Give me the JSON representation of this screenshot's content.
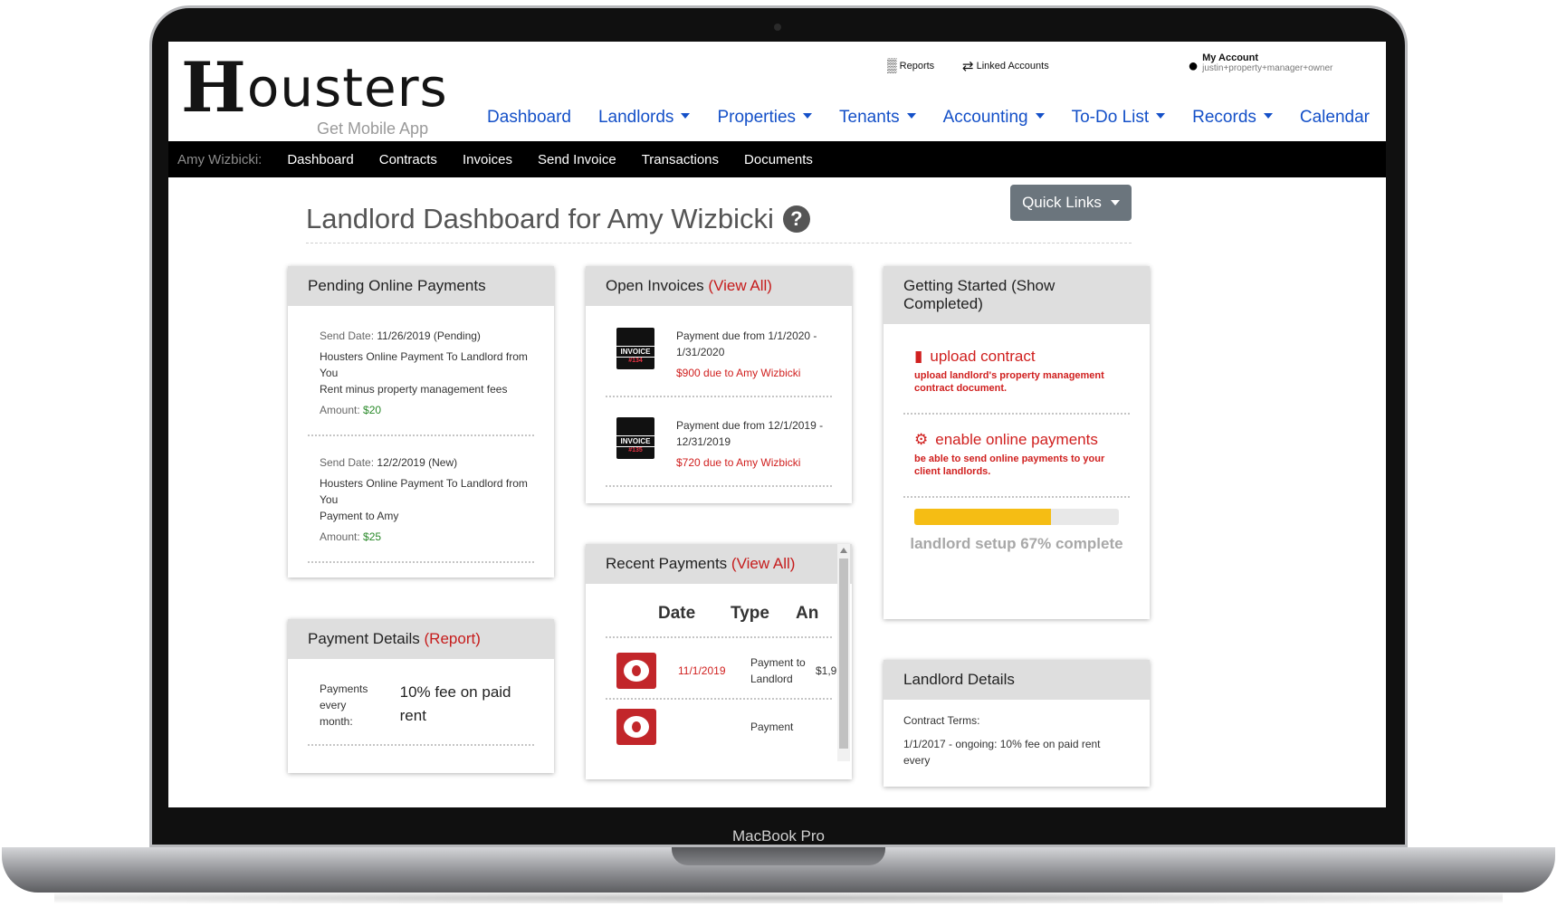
{
  "device": {
    "label": "MacBook Pro"
  },
  "header": {
    "logo": "Housters",
    "logo_first": "H",
    "logo_rest": "ousters",
    "mobile_app": "Get Mobile App",
    "utility": {
      "reports": "Reports",
      "linked_accounts": "Linked Accounts",
      "my_account": "My Account",
      "account_user": "justin+property+manager+owner"
    },
    "nav": [
      {
        "label": "Dashboard",
        "dropdown": false
      },
      {
        "label": "Landlords",
        "dropdown": true
      },
      {
        "label": "Properties",
        "dropdown": true
      },
      {
        "label": "Tenants",
        "dropdown": true
      },
      {
        "label": "Accounting",
        "dropdown": true
      },
      {
        "label": "To-Do List",
        "dropdown": true
      },
      {
        "label": "Records",
        "dropdown": true
      },
      {
        "label": "Calendar",
        "dropdown": false
      }
    ]
  },
  "subnav": {
    "context": "Amy Wizbicki:",
    "items": [
      "Dashboard",
      "Contracts",
      "Invoices",
      "Send Invoice",
      "Transactions",
      "Documents"
    ]
  },
  "page": {
    "title": "Landlord Dashboard for Amy Wizbicki",
    "quick_links": "Quick Links",
    "help_icon": "?"
  },
  "pending_payments": {
    "title": "Pending Online Payments",
    "entries": [
      {
        "send_label": "Send Date:",
        "send_date": "11/26/2019 (Pending)",
        "desc1": "Housters Online Payment To Landlord from You",
        "desc2": "Rent minus property management fees",
        "amount_label": "Amount:",
        "amount": "$20"
      },
      {
        "send_label": "Send Date:",
        "send_date": "12/2/2019 (New)",
        "desc1": "Housters Online Payment To Landlord from You",
        "desc2": "Payment to Amy",
        "amount_label": "Amount:",
        "amount": "$25"
      }
    ]
  },
  "open_invoices": {
    "title": "Open Invoices",
    "view_all": "(View All)",
    "icon_text": "INVOICE",
    "items": [
      {
        "number": "#134",
        "period": "Payment due from 1/1/2020 - 1/31/2020",
        "due": "$900 due to Amy Wizbicki"
      },
      {
        "number": "#135",
        "period": "Payment due from 12/1/2019 - 12/31/2019",
        "due": "$720 due to Amy Wizbicki"
      }
    ]
  },
  "getting_started": {
    "title": "Getting Started (Show Completed)",
    "items": [
      {
        "icon": "file-icon",
        "title": "upload contract",
        "desc": "upload landlord's property management contract document."
      },
      {
        "icon": "gear-icon",
        "title": "enable online payments",
        "desc": "be able to send online payments to your client landlords."
      }
    ],
    "progress_percent": 67,
    "progress_label": "landlord setup 67% complete"
  },
  "recent_payments": {
    "title": "Recent Payments",
    "view_all": "(View All)",
    "columns": [
      "Date",
      "Type",
      "An"
    ],
    "rows": [
      {
        "date": "11/1/2019",
        "type": "Payment to Landlord",
        "amount": "$1,9"
      },
      {
        "date": "",
        "type": "Payment",
        "amount": ""
      }
    ]
  },
  "payment_details": {
    "title": "Payment Details",
    "report": "(Report)",
    "label": "Payments every month:",
    "value": "10% fee on paid rent"
  },
  "landlord_details": {
    "title": "Landlord Details",
    "terms_label": "Contract Terms:",
    "terms": "1/1/2017 - ongoing: 10% fee on paid rent every"
  },
  "colors": {
    "link_blue": "#1450c8",
    "accent_red": "#d0201f",
    "progress_yellow": "#f5bd14",
    "amount_green": "#2a8a2a"
  }
}
